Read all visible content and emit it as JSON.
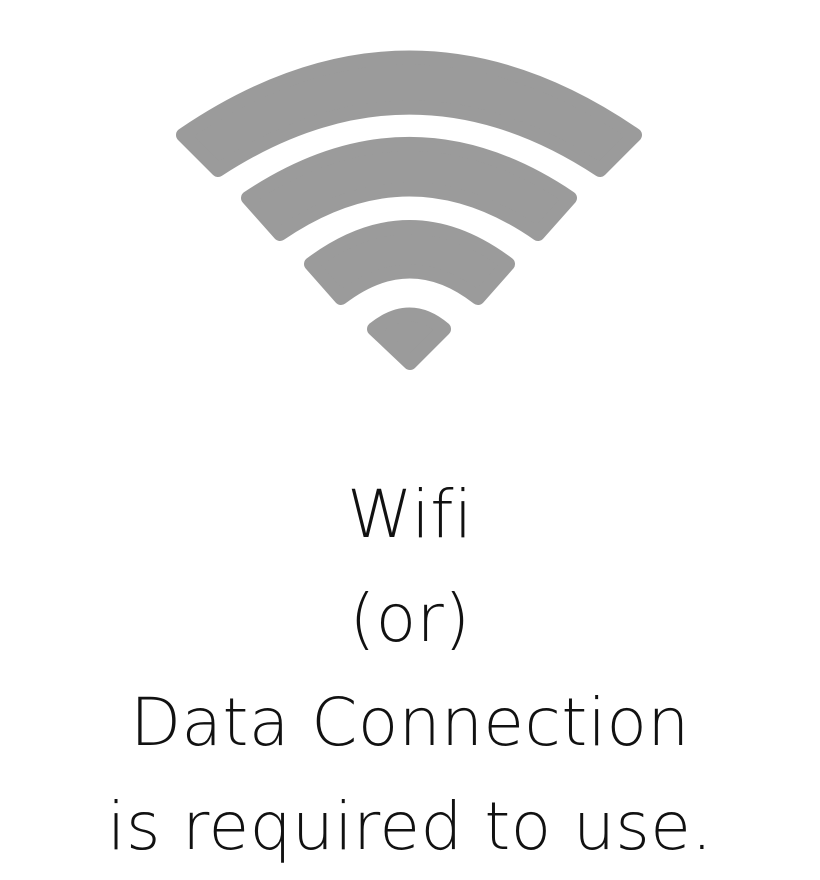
{
  "icon": {
    "name": "wifi-icon",
    "color": "#9b9b9b"
  },
  "message": {
    "line1": "Wifi",
    "line2": "(or)",
    "line3": "Data Connection",
    "line4": "is required to use."
  },
  "colors": {
    "background": "#ffffff",
    "text": "#111111"
  }
}
